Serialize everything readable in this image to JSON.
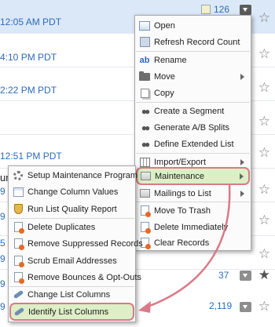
{
  "background": {
    "rows": [
      {
        "time": "12:05 AM PDT",
        "count": "126"
      },
      {
        "time": "4:10 PM PDT"
      },
      {
        "time": "2:22 PM PDT"
      },
      {
        "time": ""
      },
      {
        "time": "12:51 PM PDT"
      }
    ],
    "edge_fragments": [
      "um",
      "9",
      "9",
      "5",
      "9",
      "9",
      "9"
    ],
    "counts": [
      "37",
      "2,119"
    ]
  },
  "main_menu": {
    "items": [
      {
        "label": "Open",
        "icon": "open-icon"
      },
      {
        "label": "Refresh Record Count",
        "icon": "refresh-icon"
      },
      {
        "label": "Rename",
        "icon": "rename-icon"
      },
      {
        "label": "Move",
        "icon": "folder-icon",
        "submenu": true
      },
      {
        "label": "Copy",
        "icon": "copy-icon"
      },
      {
        "label": "Create a Segment",
        "icon": "people-icon"
      },
      {
        "label": "Generate A/B Splits",
        "icon": "people-icon"
      },
      {
        "label": "Define Extended List",
        "icon": "people-icon"
      },
      {
        "label": "Import/Export",
        "icon": "grid-icon",
        "submenu": true
      },
      {
        "label": "Maintenance",
        "icon": "box-icon",
        "submenu": true,
        "highlighted": true
      },
      {
        "label": "Mailings to List",
        "icon": "box-icon",
        "submenu": true
      },
      {
        "label": "Move To Trash",
        "icon": "doc-icon"
      },
      {
        "label": "Delete Immediately",
        "icon": "doc-icon"
      },
      {
        "label": "Clear Records",
        "icon": "doc-icon"
      }
    ]
  },
  "maintenance_menu": {
    "items": [
      {
        "label": "Setup Maintenance Program",
        "icon": "gear-icon"
      },
      {
        "label": "Change Column Values",
        "icon": "sheet-icon"
      },
      {
        "label": "Run List Quality Report",
        "icon": "shield-icon"
      },
      {
        "label": "Delete Duplicates",
        "icon": "doc-icon"
      },
      {
        "label": "Remove Suppressed Records",
        "icon": "doc-icon"
      },
      {
        "label": "Scrub Email Addresses",
        "icon": "doc-icon"
      },
      {
        "label": "Remove Bounces & Opt-Outs",
        "icon": "doc-icon"
      },
      {
        "label": "Change List Columns",
        "icon": "key-icon"
      },
      {
        "label": "Identify List Columns",
        "icon": "key-icon",
        "highlighted": true
      }
    ]
  },
  "colors": {
    "highlight_fill": "#dcefc6",
    "highlight_border": "#d97a86",
    "link_blue": "#2e6bb8"
  }
}
